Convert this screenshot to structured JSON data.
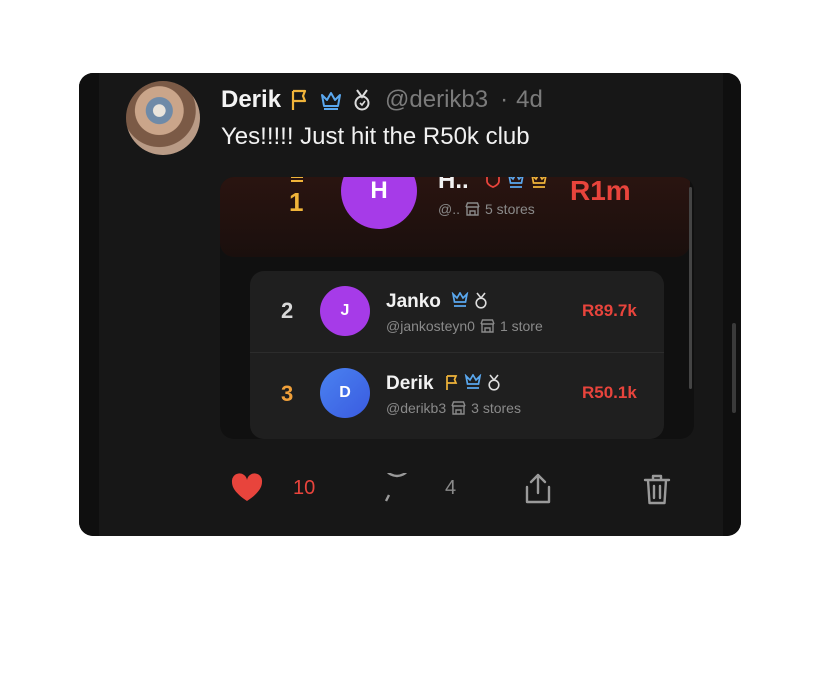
{
  "post": {
    "author_name": "Derik",
    "handle": "@derikb3",
    "separator": "·",
    "time_ago": "4d",
    "text": "Yes!!!!! Just hit the R50k club"
  },
  "leaderboard": {
    "first": {
      "rank": "1",
      "initial": "H",
      "name": "H..",
      "handle": "@..",
      "stores": "5 stores",
      "amount": "R1m"
    },
    "rows": [
      {
        "rank": "2",
        "initial": "J",
        "name": "Janko",
        "handle": "@jankosteyn0",
        "stores": "1 store",
        "amount": "R89.7k"
      },
      {
        "rank": "3",
        "initial": "D",
        "name": "Derik",
        "handle": "@derikb3",
        "stores": "3 stores",
        "amount": "R50.1k"
      }
    ]
  },
  "actions": {
    "likes": "10",
    "comments": "4"
  },
  "colors": {
    "accent_red": "#e8443c",
    "gold": "#f0b43a",
    "blue": "#5aa8ef",
    "card_bg": "#171717"
  }
}
